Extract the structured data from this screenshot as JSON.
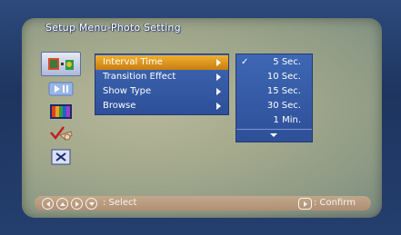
{
  "title": "Setup Menu-Photo Setting",
  "sidebar": {
    "items": [
      {
        "icon": "photo-setting-icon",
        "selected": true
      },
      {
        "icon": "music-setting-icon",
        "selected": false
      },
      {
        "icon": "display-setting-icon",
        "selected": false
      },
      {
        "icon": "check-tools-icon",
        "selected": false
      },
      {
        "icon": "exit-icon",
        "selected": false
      }
    ]
  },
  "menu": {
    "items": [
      {
        "label": "Interval Time",
        "selected": true
      },
      {
        "label": "Transition Effect",
        "selected": false
      },
      {
        "label": "Show Type",
        "selected": false
      },
      {
        "label": "Browse",
        "selected": false
      }
    ]
  },
  "submenu": {
    "check": "✓",
    "items": [
      {
        "label": "5 Sec.",
        "checked": true
      },
      {
        "label": "10 Sec.",
        "checked": false
      },
      {
        "label": "15 Sec.",
        "checked": false
      },
      {
        "label": "30 Sec.",
        "checked": false
      },
      {
        "label": "1 Min.",
        "checked": false
      }
    ]
  },
  "footer": {
    "select_text": ": Select",
    "confirm_text": ": Confirm"
  },
  "colors": {
    "menu_bg": "#2e4f98",
    "highlight": "#e09a20",
    "footer_bg": "#c8a98a"
  }
}
